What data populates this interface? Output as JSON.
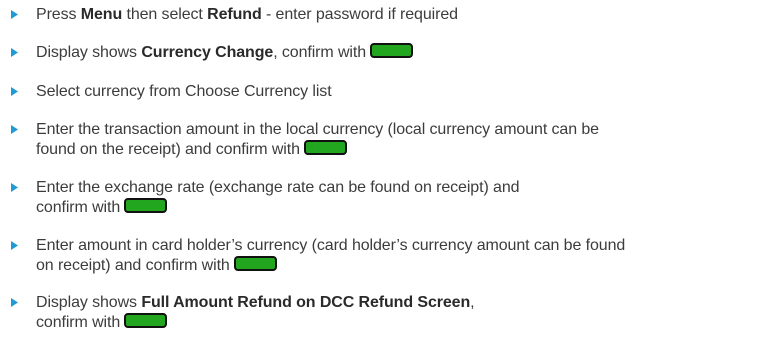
{
  "colors": {
    "bullet": "#1e9bd7",
    "confirm_key": "#22a51f",
    "text": "#3c3c3c"
  },
  "icons": {
    "bullet": "triangle-bullet-icon",
    "confirm": "green-confirm-key-icon"
  },
  "steps": [
    {
      "p1": "Press ",
      "b1": "Menu",
      "p2": " then select ",
      "b2": "Refund",
      "p3": " - enter password if required"
    },
    {
      "p1": "Display shows ",
      "b1": "Currency Change",
      "p2": ", confirm with"
    },
    {
      "p1": "Select currency from Choose Currency list"
    },
    {
      "l1": "Enter the transaction amount in the local currency (local currency amount can be",
      "l2": "found on the receipt) and confirm with"
    },
    {
      "l1": "Enter the exchange rate (exchange rate can be found on receipt) and",
      "l2": "confirm with"
    },
    {
      "l1": "Enter amount in card holder’s currency (card holder’s currency amount can be found",
      "l2": "on receipt) and confirm with"
    },
    {
      "p1": "Display shows ",
      "b1": "Full Amount Refund on DCC Refund Screen",
      "p2": ",",
      "l2": "confirm with"
    }
  ]
}
